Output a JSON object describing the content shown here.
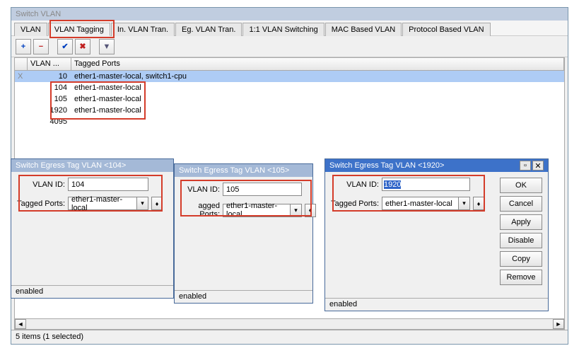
{
  "main": {
    "title": "Switch VLAN",
    "tabs": [
      "VLAN",
      "VLAN Tagging",
      "In. VLAN Tran.",
      "Eg. VLAN Tran.",
      "1:1 VLAN Switching",
      "MAC Based VLAN",
      "Protocol Based VLAN"
    ],
    "active_tab": 1,
    "columns": {
      "c0": "",
      "c1": "VLAN ...",
      "c2": "Tagged Ports"
    },
    "rows": [
      {
        "flag": "X",
        "vlan": "10",
        "ports": "ether1-master-local, switch1-cpu",
        "selected": true
      },
      {
        "flag": "",
        "vlan": "104",
        "ports": "ether1-master-local",
        "selected": false
      },
      {
        "flag": "",
        "vlan": "105",
        "ports": "ether1-master-local",
        "selected": false
      },
      {
        "flag": "",
        "vlan": "1920",
        "ports": "ether1-master-local",
        "selected": false
      },
      {
        "flag": "",
        "vlan": "4095",
        "ports": "",
        "selected": false
      }
    ],
    "status": "5 items (1 selected)"
  },
  "dlg104": {
    "title": "Switch Egress Tag VLAN <104>",
    "vlanid_label": "VLAN ID:",
    "vlanid_value": "104",
    "ports_label": "Tagged Ports:",
    "ports_value": "ether1-master-local",
    "status": "enabled"
  },
  "dlg105": {
    "title": "Switch Egress Tag VLAN <105>",
    "vlanid_label": "VLAN ID:",
    "vlanid_value": "105",
    "ports_label": "agged Ports:",
    "ports_value": "ether1-master-local",
    "status": "enabled"
  },
  "dlg1920": {
    "title": "Switch Egress Tag VLAN <1920>",
    "vlanid_label": "VLAN ID:",
    "vlanid_value": "1920",
    "ports_label": "Tagged Ports:",
    "ports_value": "ether1-master-local",
    "status": "enabled",
    "buttons": {
      "ok": "OK",
      "cancel": "Cancel",
      "apply": "Apply",
      "disable": "Disable",
      "copy": "Copy",
      "remove": "Remove"
    }
  }
}
